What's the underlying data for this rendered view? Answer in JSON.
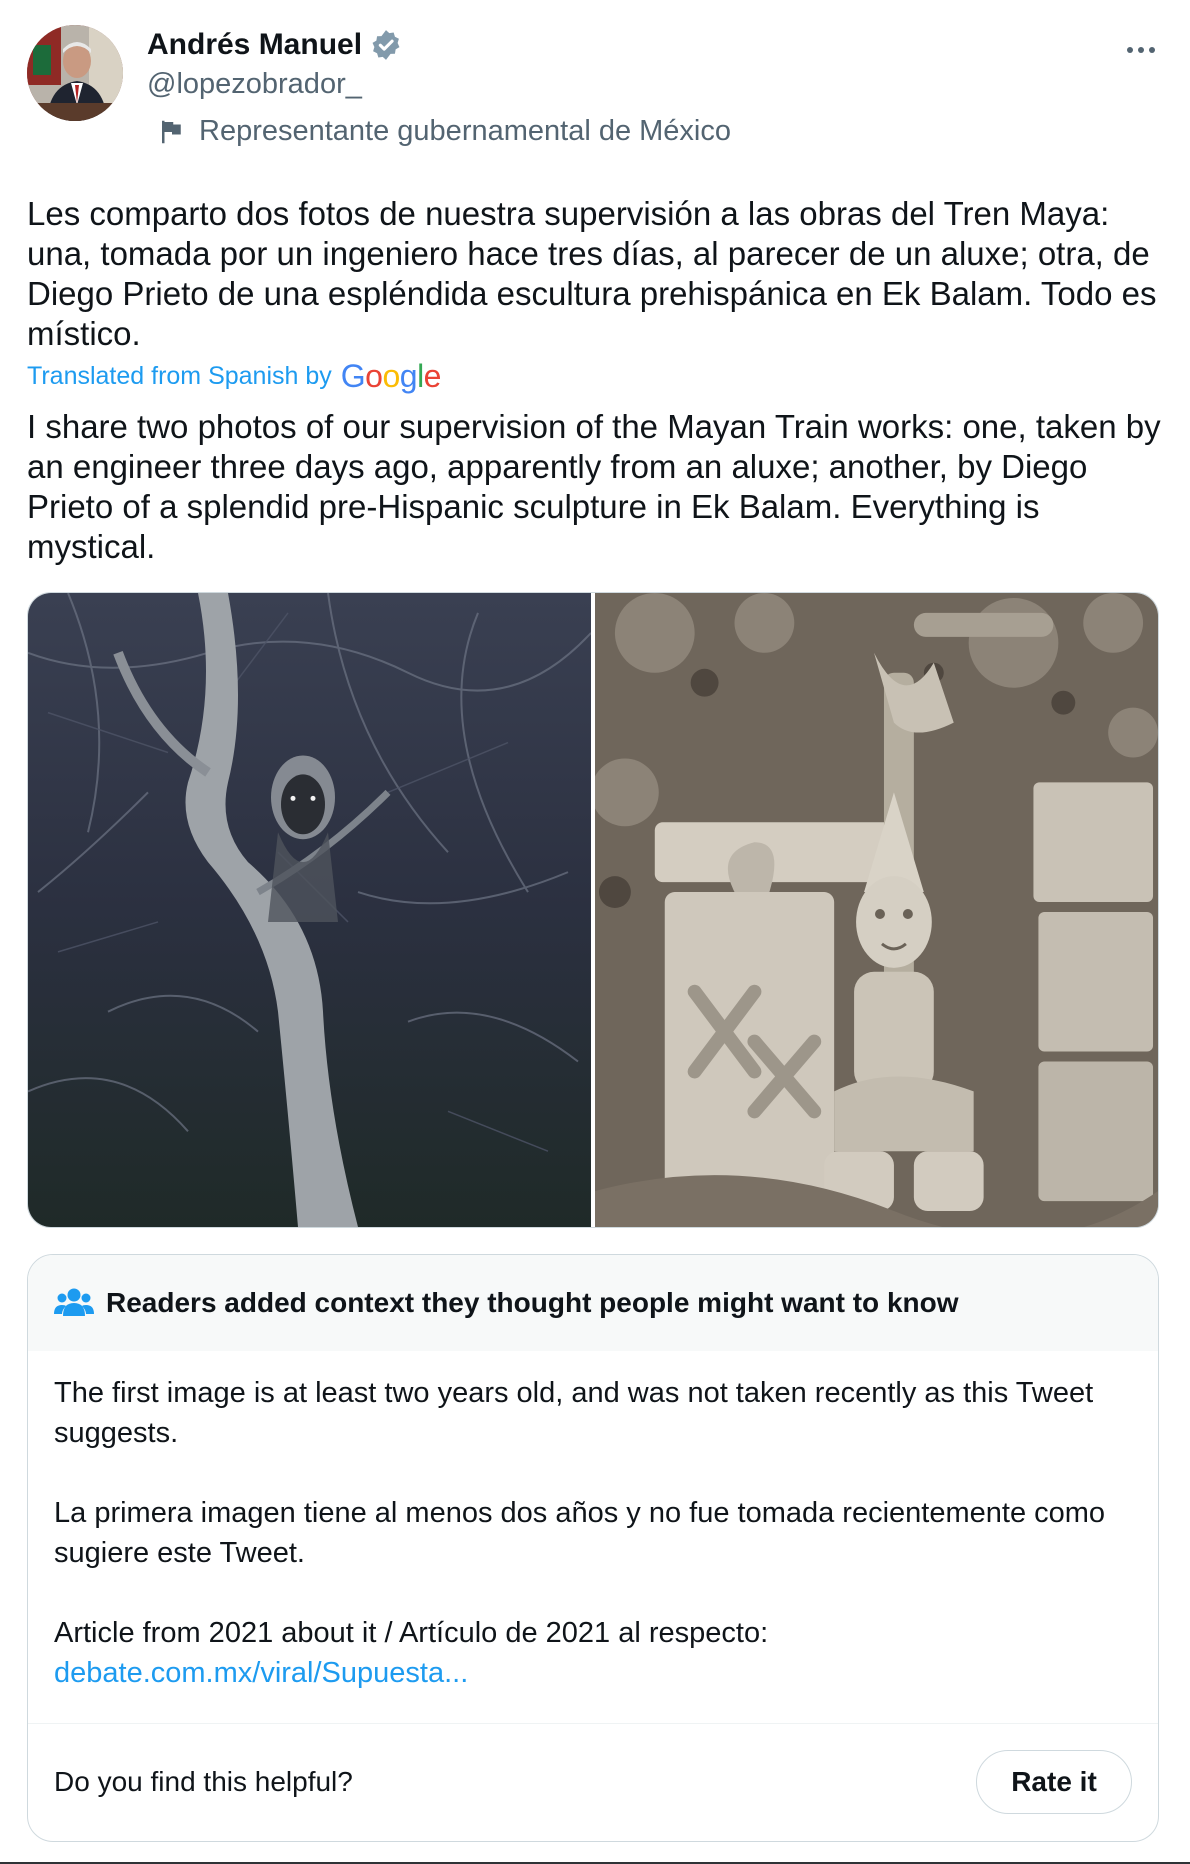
{
  "author": {
    "name": "Andrés Manuel",
    "handle": "@lopezobrador_",
    "label": "Representante gubernamental de México",
    "verified_color": "#829aab"
  },
  "tweet": {
    "text": "Les comparto dos fotos de nuestra supervisión a las obras del Tren Maya: una, tomada por un ingeniero hace tres días, al parecer de un aluxe; otra, de Diego Prieto de una espléndida escultura prehispánica en Ek Balam. Todo es místico.",
    "translated_label": "Translated from Spanish by",
    "google_letters": [
      "G",
      "o",
      "o",
      "g",
      "l",
      "e"
    ],
    "translation": "I share two photos of our supervision of the Mayan Train works: one, taken by an engineer three days ago, apparently from an aluxe; another, by Diego Prieto of a splendid pre-Hispanic sculpture in Ek Balam. Everything is mystical."
  },
  "media": {
    "photos": [
      "aluxe-tree-photo",
      "ek-balam-sculpture-photo"
    ]
  },
  "community_note": {
    "title": "Readers added context they thought people might want to know",
    "paragraph_1": "The first image is at least two years old, and was not taken recently as this Tweet suggests.",
    "paragraph_2": "La primera imagen tiene al menos dos años y no fue tomada recientemente como sugiere este Tweet.",
    "paragraph_3": "Article from 2021 about it / Artículo de 2021 al respecto:",
    "link": "debate.com.mx/viral/Supuesta...",
    "helpful_question": "Do you find this helpful?",
    "rate_label": "Rate it"
  },
  "colors": {
    "link_blue": "#1d9bf0",
    "secondary_text": "#536471",
    "border": "#cfd9de"
  }
}
